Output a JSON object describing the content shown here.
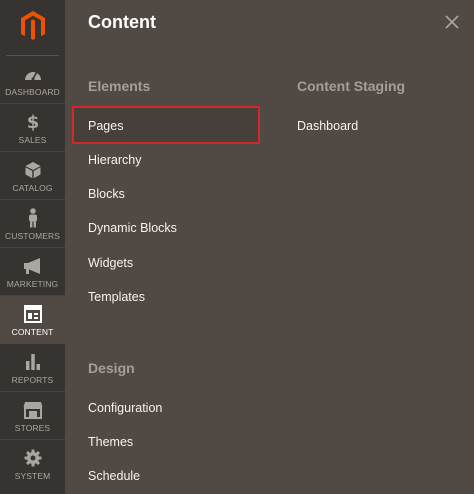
{
  "sidebar": {
    "logo_icon": "magento-logo-icon",
    "accent_color": "#eb5202",
    "items": [
      {
        "label": "DASHBOARD",
        "icon": "speedometer-icon"
      },
      {
        "label": "SALES",
        "icon": "dollar-icon"
      },
      {
        "label": "CATALOG",
        "icon": "cube-icon"
      },
      {
        "label": "CUSTOMERS",
        "icon": "person-icon"
      },
      {
        "label": "MARKETING",
        "icon": "megaphone-icon"
      },
      {
        "label": "CONTENT",
        "icon": "layout-icon",
        "active": true
      },
      {
        "label": "REPORTS",
        "icon": "bar-chart-icon"
      },
      {
        "label": "STORES",
        "icon": "storefront-icon"
      },
      {
        "label": "SYSTEM",
        "icon": "gear-icon"
      }
    ]
  },
  "panel": {
    "title": "Content",
    "close_icon": "close-icon",
    "sections": [
      {
        "title": "Elements",
        "links": [
          "Pages",
          "Hierarchy",
          "Blocks",
          "Dynamic Blocks",
          "Widgets",
          "Templates"
        ]
      },
      {
        "title": "Design",
        "links": [
          "Configuration",
          "Themes",
          "Schedule"
        ]
      },
      {
        "title": "Content Staging",
        "links": [
          "Dashboard"
        ]
      }
    ],
    "highlighted_link": "Pages",
    "highlight_color": "#d0282b"
  }
}
